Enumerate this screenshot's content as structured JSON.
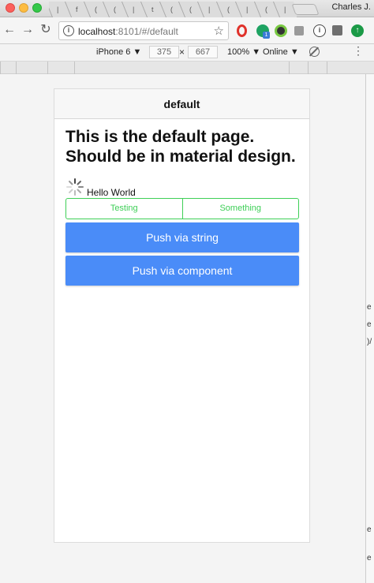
{
  "window": {
    "profile_name": "Charles J."
  },
  "toolbar": {
    "back_icon": "back-arrow-icon",
    "forward_icon": "forward-arrow-icon",
    "reload_icon": "reload-icon",
    "url_host": "localhost",
    "url_rest": ":8101/#/default"
  },
  "device_bar": {
    "device": "iPhone 6 ▼",
    "width": "375",
    "height": "667",
    "times": "×",
    "zoom": "100% ▼",
    "network": "Online ▼",
    "more": "⋮"
  },
  "app": {
    "nav_title": "default",
    "heading": "This is the default page. Should be in material design.",
    "hello": "Hello World",
    "segment": [
      "Testing",
      "Something"
    ],
    "push_string": "Push via string",
    "push_component": "Push via component"
  },
  "colors": {
    "accent_blue": "#4a8cf8",
    "segment_green": "#3ecf57"
  }
}
